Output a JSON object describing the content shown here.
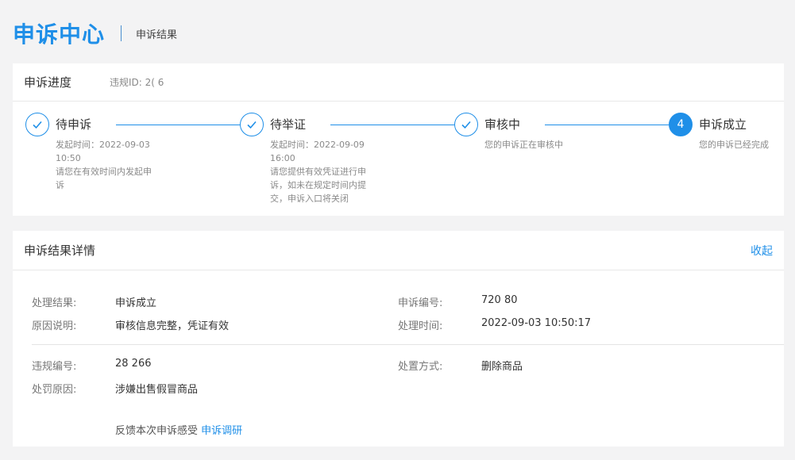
{
  "header": {
    "brand": "申诉中心",
    "crumb": "申诉结果"
  },
  "progress": {
    "title": "申诉进度",
    "violation_id": "违规ID: 2(                    6",
    "steps": [
      {
        "index": "1",
        "name": "待申诉",
        "lines": [
          "发起时间：2022-09-03",
          "10:50",
          "请您在有效时间内发起申",
          "诉"
        ],
        "done": true
      },
      {
        "index": "2",
        "name": "待举证",
        "lines": [
          "发起时间：2022-09-09",
          "16:00",
          "请您提供有效凭证进行申",
          "诉，如未在规定时间内提",
          "交，申诉入口将关闭"
        ],
        "done": true
      },
      {
        "index": "3",
        "name": "审核中",
        "lines": [
          "您的申诉正在审核中"
        ],
        "done": true
      },
      {
        "index": "4",
        "name": "申诉成立",
        "lines": [
          "您的申诉已经完成"
        ],
        "done": false
      }
    ]
  },
  "result": {
    "title": "申诉结果详情",
    "collapse_label": "收起",
    "fields": {
      "result_label": "处理结果:",
      "result_value": "申诉成立",
      "appeal_no_label": "申诉编号:",
      "appeal_no_value": "720                    80",
      "reason_label": "原因说明:",
      "reason_value": "审核信息完整，凭证有效",
      "time_label": "处理时间:",
      "time_value": "2022-09-03 10:50:17",
      "violation_no_label": "违规编号:",
      "violation_no_value": "28           266",
      "method_label": "处置方式:",
      "method_value": "删除商品",
      "punish_label": "处罚原因:",
      "punish_value": "涉嫌出售假冒商品"
    },
    "feedback_text": "反馈本次申诉感受",
    "feedback_link": "申诉调研"
  },
  "colors": {
    "accent": "#1f8fe8",
    "background": "#f3f3f4"
  },
  "icons": {
    "check": "check-icon"
  }
}
